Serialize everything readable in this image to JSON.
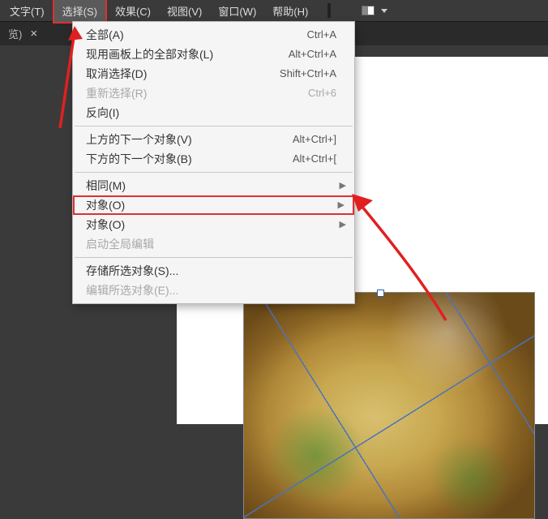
{
  "menubar": {
    "text": "文字(T)",
    "select": "选择(S)",
    "effect": "效果(C)",
    "view": "视图(V)",
    "window": "窗口(W)",
    "help": "帮助(H)"
  },
  "tab": {
    "label": "览)",
    "close": "×"
  },
  "dropdown": {
    "all": {
      "label": "全部(A)",
      "shortcut": "Ctrl+A"
    },
    "allOnArtboard": {
      "label": "现用画板上的全部对象(L)",
      "shortcut": "Alt+Ctrl+A"
    },
    "deselect": {
      "label": "取消选择(D)",
      "shortcut": "Shift+Ctrl+A"
    },
    "reselect": {
      "label": "重新选择(R)",
      "shortcut": "Ctrl+6"
    },
    "inverse": {
      "label": "反向(I)"
    },
    "nextAbove": {
      "label": "上方的下一个对象(V)",
      "shortcut": "Alt+Ctrl+]"
    },
    "nextBelow": {
      "label": "下方的下一个对象(B)",
      "shortcut": "Alt+Ctrl+["
    },
    "same": {
      "label": "相同(M)"
    },
    "object_h": {
      "label": "对象(O)"
    },
    "object": {
      "label": "对象(O)"
    },
    "startGlobalEdit": {
      "label": "启动全局编辑"
    },
    "saveSelection": {
      "label": "存储所选对象(S)..."
    },
    "editSelection": {
      "label": "编辑所选对象(E)..."
    }
  }
}
